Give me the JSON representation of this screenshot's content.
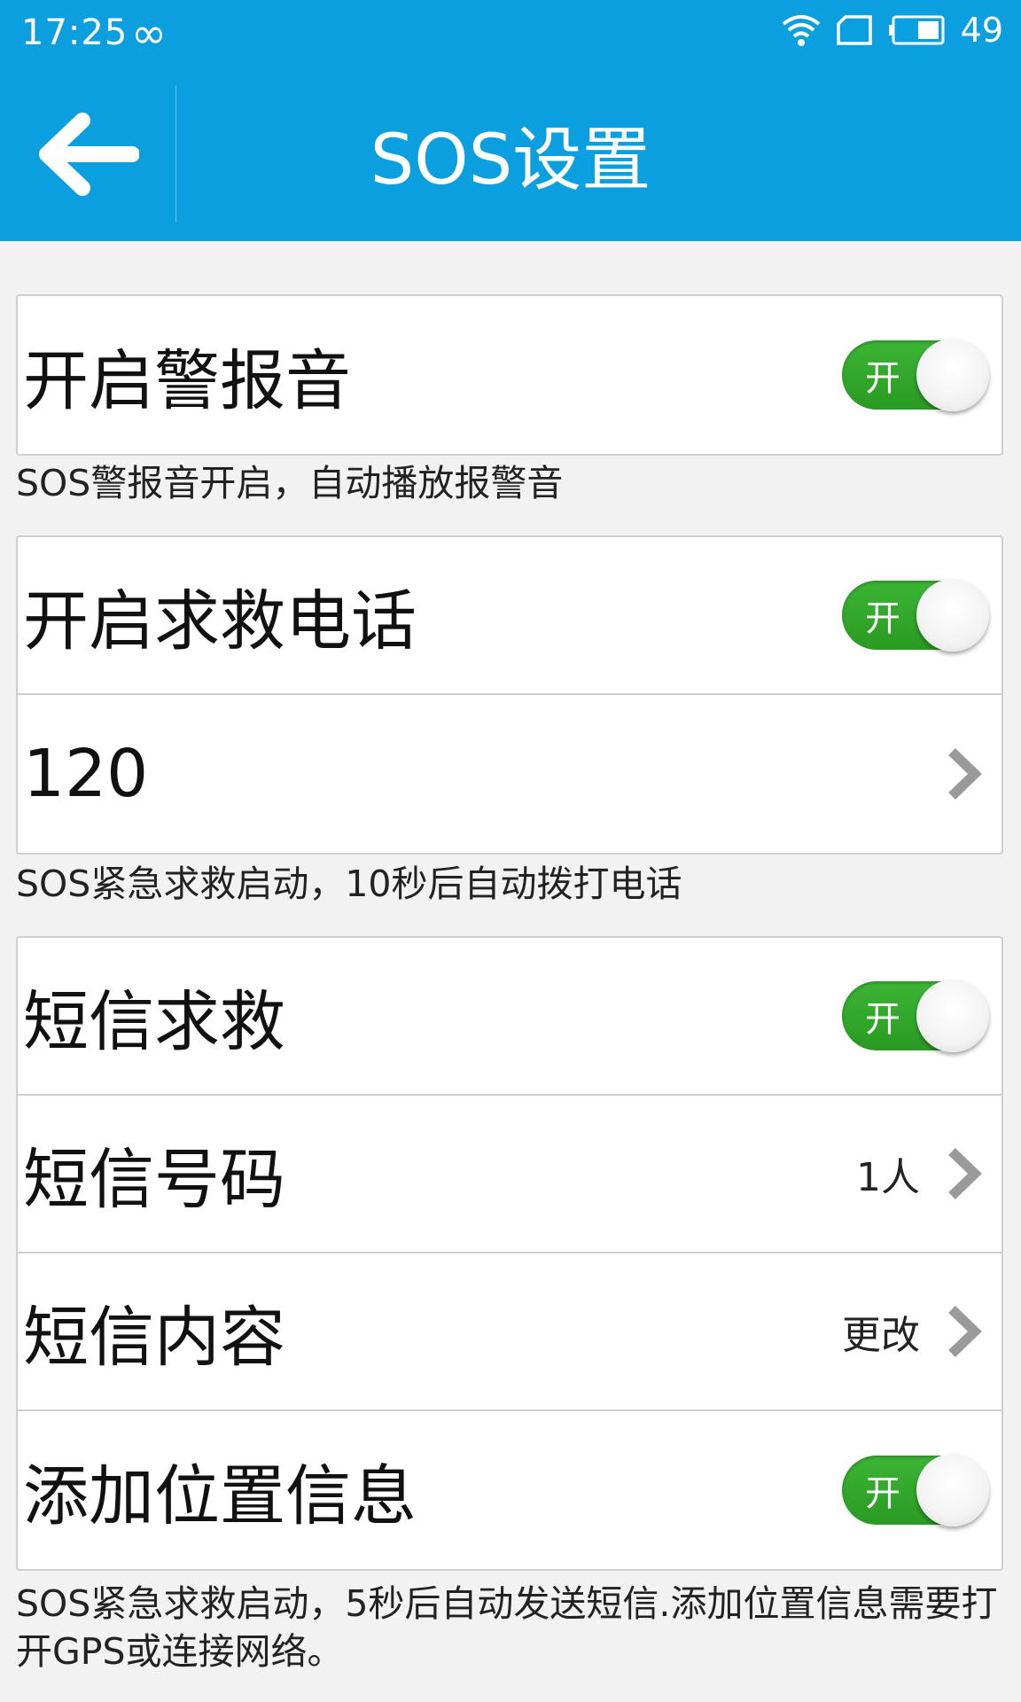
{
  "status_bar": {
    "time": "17:25",
    "battery": "49"
  },
  "header": {
    "title": "SOS设置"
  },
  "alarm_group": {
    "alarm_label": "开启警报音",
    "alarm_toggle": "开"
  },
  "alarm_desc": "SOS警报音开启，自动播放报警音",
  "call_group": {
    "call_label": "开启求救电话",
    "call_toggle": "开",
    "number": "120"
  },
  "call_desc": "SOS紧急求救启动，10秒后自动拨打电话",
  "sms_group": {
    "sms_label": "短信求救",
    "sms_toggle": "开",
    "sms_number_label": "短信号码",
    "sms_number_value": "1人",
    "sms_content_label": "短信内容",
    "sms_content_value": "更改",
    "location_label": "添加位置信息",
    "location_toggle": "开"
  },
  "sms_desc": "SOS紧急求救启动，5秒后自动发送短信.添加位置信息需要打开GPS或连接网络。",
  "colors": {
    "header_bg": "#0b9fe0",
    "toggle_on": "#2fa829"
  },
  "icons": [
    "back-arrow-icon",
    "infinity-icon",
    "wifi-icon",
    "sim-icon",
    "battery-icon",
    "chevron-right-icon"
  ]
}
